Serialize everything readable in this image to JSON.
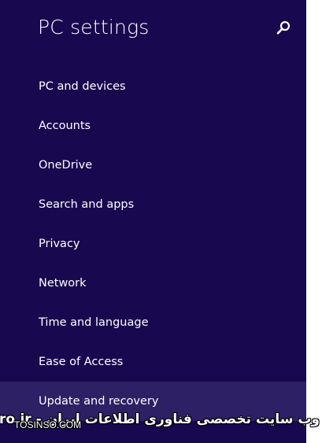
{
  "header": {
    "title": "PC settings",
    "search_icon": "search-icon"
  },
  "nav": {
    "items": [
      {
        "label": "PC and devices"
      },
      {
        "label": "Accounts"
      },
      {
        "label": "OneDrive"
      },
      {
        "label": "Search and apps"
      },
      {
        "label": "Privacy"
      },
      {
        "label": "Network"
      },
      {
        "label": "Time and language"
      },
      {
        "label": "Ease of Access"
      },
      {
        "label": "Update and recovery",
        "selected": true
      }
    ]
  },
  "watermark": {
    "main": "ITPro.ir - وب سایت تخصصی فناوری اطلاعات ایران",
    "sub": "TOSINSO.COM"
  },
  "colors": {
    "panel_background": "#180850",
    "selected_background": "#2d2065",
    "text": "#ffffff"
  }
}
